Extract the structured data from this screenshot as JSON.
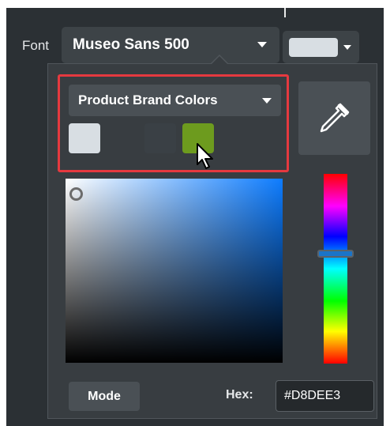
{
  "toolbar": {
    "font_label": "Font",
    "font_value": "Museo Sans 500",
    "text_color": "#D8DEE3"
  },
  "color_picker": {
    "palette_value": "Product Brand Colors",
    "swatches": [
      {
        "color": "#D8DEE3"
      },
      {
        "color": "#3A4045"
      },
      {
        "color": "#6D9B1E"
      }
    ],
    "highlight_color": "#E5393F",
    "mode_label": "Mode",
    "hex_label": "Hex:",
    "hex_value": "#D8DEE3"
  }
}
